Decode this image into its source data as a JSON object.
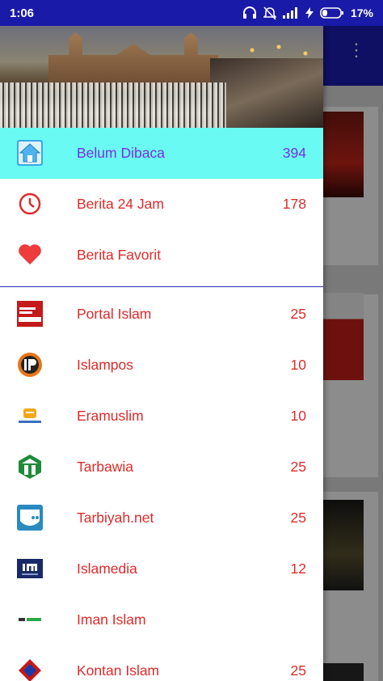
{
  "status_bar": {
    "time": "1:06",
    "battery": "17%"
  },
  "drawer": {
    "primary_items": [
      {
        "label": "Belum Dibaca",
        "count": "394",
        "icon": "home-icon",
        "active": true
      },
      {
        "label": "Berita 24 Jam",
        "count": "178",
        "icon": "clock-icon"
      },
      {
        "label": "Berita Favorit",
        "count": "",
        "icon": "heart-icon"
      }
    ],
    "sources": [
      {
        "label": "Portal Islam",
        "count": "25",
        "icon": "portal-islam-logo"
      },
      {
        "label": "Islampos",
        "count": "10",
        "icon": "islampos-logo"
      },
      {
        "label": "Eramuslim",
        "count": "10",
        "icon": "eramuslim-logo"
      },
      {
        "label": "Tarbawia",
        "count": "25",
        "icon": "tarbawia-logo"
      },
      {
        "label": "Tarbiyah.net",
        "count": "25",
        "icon": "tarbiyah-logo"
      },
      {
        "label": "Islamedia",
        "count": "12",
        "icon": "islamedia-logo"
      },
      {
        "label": "Iman Islam",
        "count": "",
        "icon": "iman-islam-logo"
      },
      {
        "label": "Kontan Islam",
        "count": "25",
        "icon": "kontan-islam-logo"
      }
    ]
  },
  "colors": {
    "status_bar": "#1a1aa8",
    "active_row": "#69fbf3",
    "active_text": "#7b2fe6",
    "item_text": "#e02a2a",
    "divider": "#2a2ab0"
  }
}
